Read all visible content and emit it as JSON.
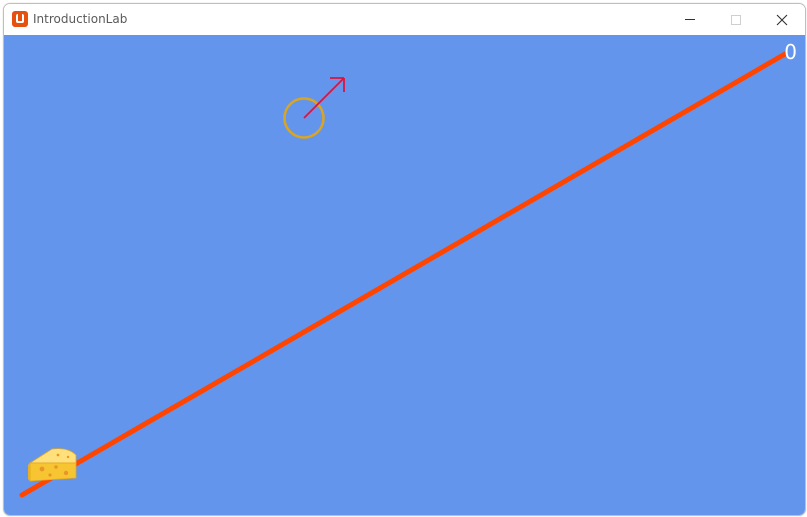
{
  "window": {
    "title": "IntroductionLab"
  },
  "game": {
    "score": "0",
    "colors": {
      "background": "#6495ed",
      "line": "#ff4500",
      "ring": "#daa520",
      "arrow": "#dc143c",
      "cheese": "#f7c531"
    }
  },
  "icons": {
    "app": "monogame-icon",
    "minimize": "minimize-icon",
    "maximize": "maximize-icon",
    "close": "close-icon",
    "player": "cheese-icon"
  }
}
